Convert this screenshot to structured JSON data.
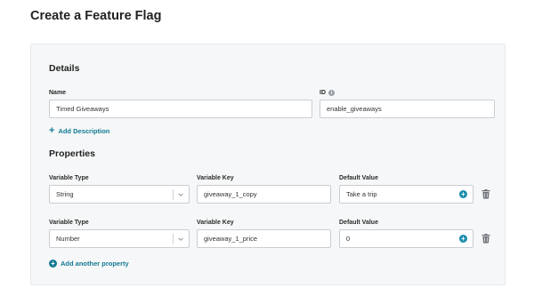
{
  "page": {
    "title": "Create a Feature Flag"
  },
  "details": {
    "title": "Details",
    "name_label": "Name",
    "name_value": "Timed Giveaways",
    "id_label": "ID",
    "id_value": "enable_giveaways",
    "add_description": "Add Description"
  },
  "properties": {
    "title": "Properties",
    "rows": [
      {
        "variable_type_label": "Variable Type",
        "variable_type_value": "String",
        "variable_key_label": "Variable Key",
        "variable_key_value": "giveaway_1_copy",
        "default_value_label": "Default Value",
        "default_value": "Take a trip"
      },
      {
        "variable_type_label": "Variable Type",
        "variable_type_value": "Number",
        "variable_key_label": "Variable Key",
        "variable_key_value": "giveaway_1_price",
        "default_value_label": "Default Value",
        "default_value": "0"
      }
    ],
    "add_another": "Add another property"
  },
  "icons": {
    "info": "info-icon",
    "plus": "plus-icon",
    "chevron": "chevron-down-icon",
    "trash": "trash-icon"
  },
  "colors": {
    "accent": "#137a93",
    "card_bg": "#f6f7f8"
  }
}
